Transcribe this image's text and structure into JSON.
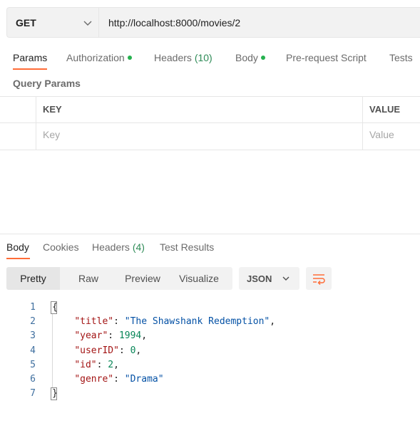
{
  "request": {
    "method": "GET",
    "url": "http://localhost:8000/movies/2"
  },
  "request_tabs": [
    {
      "label": "Params",
      "active": true
    },
    {
      "label": "Authorization",
      "dot": true
    },
    {
      "label": "Headers",
      "count": "(10)"
    },
    {
      "label": "Body",
      "dot": true
    },
    {
      "label": "Pre-request Script"
    },
    {
      "label": "Tests"
    }
  ],
  "query_params": {
    "title": "Query Params",
    "columns": [
      "KEY",
      "VALUE"
    ],
    "placeholders": {
      "key": "Key",
      "value": "Value"
    }
  },
  "response_tabs": [
    {
      "label": "Body",
      "active": true
    },
    {
      "label": "Cookies"
    },
    {
      "label": "Headers",
      "count": "(4)"
    },
    {
      "label": "Test Results"
    }
  ],
  "view_modes": [
    "Pretty",
    "Raw",
    "Preview",
    "Visualize"
  ],
  "active_view": "Pretty",
  "language": "JSON",
  "icons": {
    "method_dropdown": "chevron-down-icon",
    "language_dropdown": "chevron-down-icon",
    "wrap": "wrap-lines-icon"
  },
  "colors": {
    "accent": "#ff6c37",
    "dot": "#26b14f"
  },
  "response_body": {
    "line_numbers": [
      "1",
      "2",
      "3",
      "4",
      "5",
      "6",
      "7"
    ],
    "open_brace": "{",
    "close_brace": "}",
    "fields": [
      {
        "key": "\"title\"",
        "value": "\"The Shawshank Redemption\"",
        "type": "string",
        "comma": ","
      },
      {
        "key": "\"year\"",
        "value": "1994",
        "type": "number",
        "comma": ","
      },
      {
        "key": "\"userID\"",
        "value": "0",
        "type": "number",
        "comma": ","
      },
      {
        "key": "\"id\"",
        "value": "2",
        "type": "number",
        "comma": ","
      },
      {
        "key": "\"genre\"",
        "value": "\"Drama\"",
        "type": "string",
        "comma": ""
      }
    ]
  }
}
